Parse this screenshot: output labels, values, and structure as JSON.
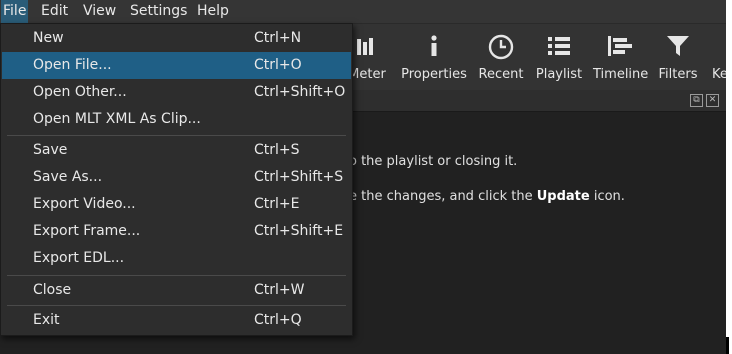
{
  "menubar": {
    "file": "File",
    "edit": "Edit",
    "view": "View",
    "settings": "Settings",
    "help": "Help"
  },
  "toolbar": {
    "meter": "Meter",
    "properties": "Properties",
    "recent": "Recent",
    "playlist": "Playlist",
    "timeline": "Timeline",
    "filters": "Filters",
    "keyframes": "Ke"
  },
  "content": {
    "line1": "o the playlist or closing it.",
    "line2_pre": "e the changes, and click the ",
    "line2_bold": "Update",
    "line2_post": " icon."
  },
  "file_menu": {
    "items": [
      {
        "label": "New",
        "shortcut": "Ctrl+N"
      },
      {
        "label": "Open File...",
        "shortcut": "Ctrl+O"
      },
      {
        "label": "Open Other...",
        "shortcut": "Ctrl+Shift+O"
      },
      {
        "label": "Open MLT XML As Clip...",
        "shortcut": ""
      },
      {
        "label": "Save",
        "shortcut": "Ctrl+S"
      },
      {
        "label": "Save As...",
        "shortcut": "Ctrl+Shift+S"
      },
      {
        "label": "Export Video...",
        "shortcut": "Ctrl+E"
      },
      {
        "label": "Export Frame...",
        "shortcut": "Ctrl+Shift+E"
      },
      {
        "label": "Export EDL...",
        "shortcut": ""
      },
      {
        "label": "Close",
        "shortcut": "Ctrl+W"
      },
      {
        "label": "Exit",
        "shortcut": "Ctrl+Q"
      }
    ]
  },
  "colors": {
    "menu_highlight": "#1f5f86",
    "background": "#212121"
  }
}
